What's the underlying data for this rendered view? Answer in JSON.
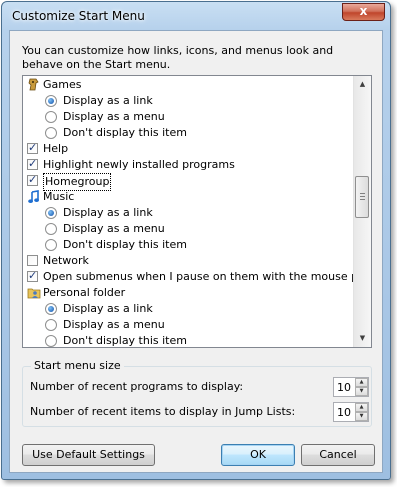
{
  "window": {
    "title": "Customize Start Menu",
    "close_glyph": "x"
  },
  "description": "You can customize how links, icons, and menus look and behave on the Start menu.",
  "list_items": [
    {
      "kind": "header",
      "icon": "games-icon",
      "label": "Games"
    },
    {
      "kind": "radio",
      "label": "Display as a link",
      "selected": true
    },
    {
      "kind": "radio",
      "label": "Display as a menu",
      "selected": false
    },
    {
      "kind": "radio",
      "label": "Don't display this item",
      "selected": false
    },
    {
      "kind": "checkbox",
      "label": "Help",
      "checked": true
    },
    {
      "kind": "checkbox",
      "label": "Highlight newly installed programs",
      "checked": true
    },
    {
      "kind": "checkbox",
      "label": "Homegroup",
      "checked": true,
      "focused": true
    },
    {
      "kind": "header",
      "icon": "music-icon",
      "label": "Music"
    },
    {
      "kind": "radio",
      "label": "Display as a link",
      "selected": true
    },
    {
      "kind": "radio",
      "label": "Display as a menu",
      "selected": false
    },
    {
      "kind": "radio",
      "label": "Don't display this item",
      "selected": false
    },
    {
      "kind": "checkbox",
      "label": "Network",
      "checked": false
    },
    {
      "kind": "checkbox",
      "label": "Open submenus when I pause on them with the mouse pointer",
      "checked": true
    },
    {
      "kind": "header",
      "icon": "personal-folder-icon",
      "label": "Personal folder"
    },
    {
      "kind": "radio",
      "label": "Display as a link",
      "selected": true
    },
    {
      "kind": "radio",
      "label": "Display as a menu",
      "selected": false
    },
    {
      "kind": "radio",
      "label": "Don't display this item",
      "selected": false
    }
  ],
  "start_menu_size": {
    "title": "Start menu size",
    "recent_programs": {
      "label": "Number of recent programs to display:",
      "value": "10"
    },
    "recent_items": {
      "label": "Number of recent items to display in Jump Lists:",
      "value": "10"
    }
  },
  "buttons": {
    "defaults": "Use Default Settings",
    "ok": "OK",
    "cancel": "Cancel"
  },
  "colors": {
    "title_bar": "#b6d1ec",
    "dialog_face": "#f0f0f0",
    "close_button": "#c0462c",
    "ok_button": "#bee6fd"
  }
}
